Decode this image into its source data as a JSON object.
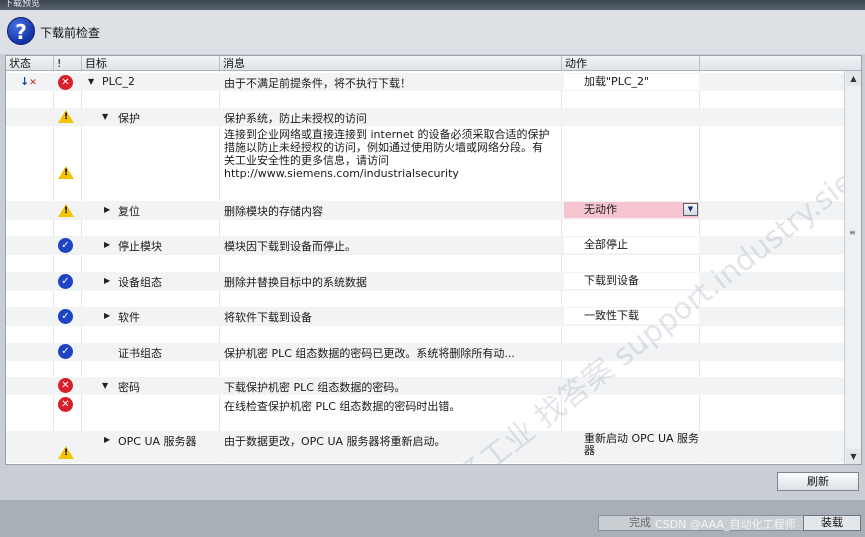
{
  "window": {
    "title": "下载预览"
  },
  "header": {
    "title": "下载前检查"
  },
  "columns": {
    "status": "状态",
    "bang": "!",
    "target": "目标",
    "message": "消息",
    "action": "动作"
  },
  "rows": [
    {
      "target": "PLC_2",
      "message": "由于不满足前提条件，将不执行下载！",
      "action": "加载\"PLC_2\""
    },
    {
      "target": "保护",
      "message": "保护系统，防止未授权的访问"
    },
    {
      "message_lines": [
        "连接到企业网络或直接连接到 internet 的设备必须采取合适的保护",
        "措施以防止未经授权的访问，例如通过使用防火墙或网络分段。有",
        "关工业安全性的更多信息，请访问",
        "http://www.siemens.com/industrialsecurity"
      ]
    },
    {
      "target": "复位",
      "message": "删除模块的存储内容",
      "action": "无动作"
    },
    {
      "target": "停止模块",
      "message": "模块因下载到设备而停止。",
      "action": "全部停止"
    },
    {
      "target": "设备组态",
      "message": "删除并替换目标中的系统数据",
      "action": "下载到设备"
    },
    {
      "target": "软件",
      "message": "将软件下载到设备",
      "action": "一致性下载"
    },
    {
      "target": "证书组态",
      "message": "保护机密 PLC 组态数据的密码已更改。系统将删除所有动..."
    },
    {
      "target": "密码",
      "message": "下载保护机密 PLC 组态数据的密码。"
    },
    {
      "message": "在线检查保护机密 PLC 组态数据的密码时出错。"
    },
    {
      "target": "OPC UA 服务器",
      "message": "由于数据更改，OPC UA 服务器将重新启动。",
      "action_lines": [
        "重新启动 OPC UA 服务",
        "器"
      ]
    }
  ],
  "buttons": {
    "refresh": "刷新",
    "finish": "完成",
    "load": "装载"
  },
  "watermark": {
    "csdn": "CSDN @AAA_自动化工程师",
    "diag": "西门子工业 找答案 support.industry.siemens.com"
  },
  "icons": {
    "help": "help-question-icon",
    "download_status": "download-status-icon",
    "error": "error-icon",
    "warning": "warning-icon",
    "ok": "ok-check-icon"
  },
  "colors": {
    "error": "#d8202a",
    "ok": "#1f44c2",
    "warning": "#f2c500",
    "action_highlight": "#f6c5cf"
  }
}
